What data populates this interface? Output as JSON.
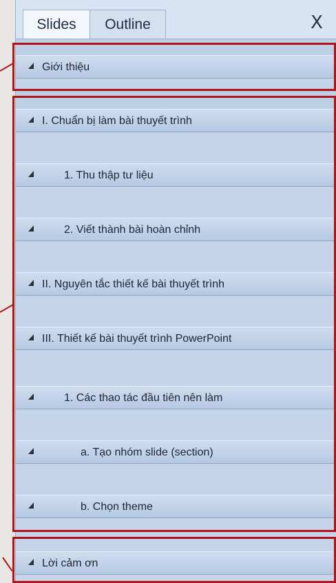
{
  "tabs": {
    "slides_label": "Slides",
    "outline_label": "Outline",
    "close_label": "X"
  },
  "sections": [
    {
      "label": "Giới thiệu"
    },
    {
      "label": "I. Chuẩn bị làm bài thuyết trình"
    },
    {
      "label": "1. Thu thập tư liệu"
    },
    {
      "label": "2. Viết thành bài hoàn chỉnh"
    },
    {
      "label": "II. Nguyên tắc thiết kế bài thuyết trình"
    },
    {
      "label": "III. Thiết kế bài thuyết trình PowerPoint"
    },
    {
      "label": "1. Các thao tác đầu tiên nên làm"
    },
    {
      "label": "a. Tạo nhóm slide (section)"
    },
    {
      "label": "b. Chọn theme"
    },
    {
      "label": "Lời cảm ơn"
    }
  ],
  "highlight_color": "#b31218"
}
